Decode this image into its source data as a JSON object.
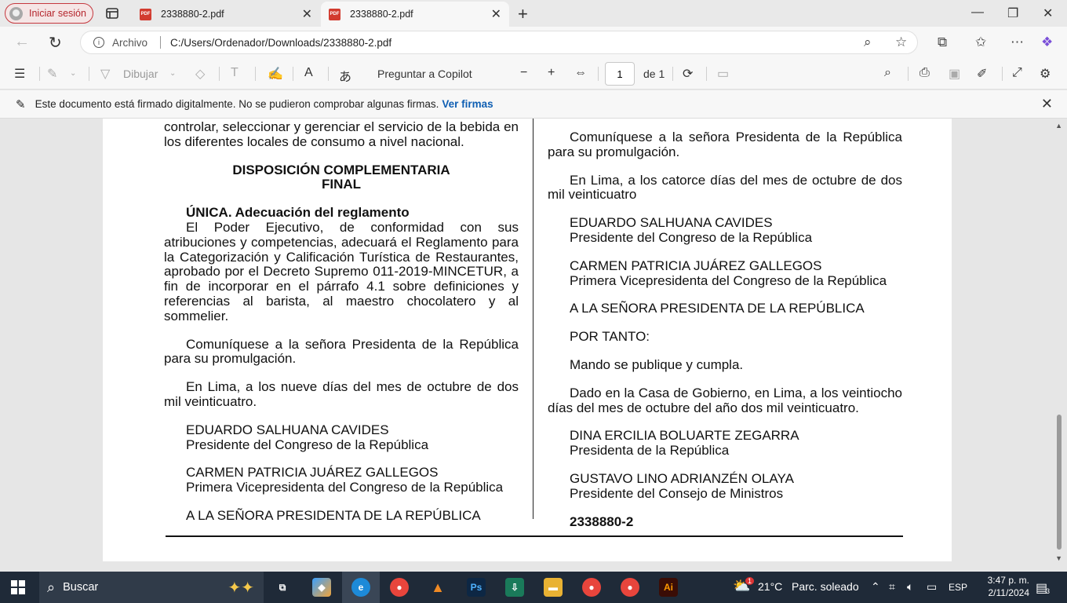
{
  "browser": {
    "signin_label": "Iniciar sesión",
    "tabs": [
      {
        "title": "2338880-2.pdf",
        "active": false
      },
      {
        "title": "2338880-2.pdf",
        "active": true
      }
    ],
    "address": {
      "scheme_label": "Archivo",
      "url": "C:/Users/Ordenador/Downloads/2338880-2.pdf"
    }
  },
  "pdf_toolbar": {
    "draw_label": "Dibujar",
    "copilot_label": "Preguntar a Copilot",
    "page_value": "1",
    "page_of": "de 1"
  },
  "signature_bar": {
    "message": "Este documento está firmado digitalmente. No se pudieron comprobar algunas firmas.",
    "link": "Ver firmas"
  },
  "document": {
    "left": {
      "top_text": "controlar, seleccionar y gerenciar el servicio de la bebida en los diferentes locales de consumo a nivel nacional.",
      "heading_line1": "DISPOSICIÓN COMPLEMENTARIA",
      "heading_line2": "FINAL",
      "article_title": "ÚNICA. Adecuación del reglamento",
      "article_body": "El Poder Ejecutivo, de conformidad con sus atribuciones y competencias, adecuará el Reglamento para la Categorización y Calificación Turística de Restaurantes, aprobado por el Decreto Supremo 011-2019-MINCETUR, a fin de incorporar en el párrafo 4.1 sobre definiciones y referencias al barista, al maestro chocolatero y al sommelier.",
      "communique": "Comuníquese a la señora Presidenta de la República para su promulgación.",
      "dated": "En Lima, a los nueve días del mes de octubre de dos mil veinticuatro.",
      "sig1_name": "EDUARDO SALHUANA CAVIDES",
      "sig1_title": "Presidente del Congreso de la República",
      "sig2_name": "CARMEN PATRICIA JUÁREZ GALLEGOS",
      "sig2_title": "Primera Vicepresidenta del Congreso de la República",
      "addressee": "A LA SEÑORA PRESIDENTA DE LA REPÚBLICA"
    },
    "right": {
      "communique": "Comuníquese a la señora Presidenta de la República para su promulgación.",
      "dated": "En Lima, a los catorce días del mes de octubre de dos mil veinticuatro",
      "sig1_name": "EDUARDO SALHUANA CAVIDES",
      "sig1_title": "Presidente del Congreso de la República",
      "sig2_name": "CARMEN PATRICIA JUÁREZ GALLEGOS",
      "sig2_title": "Primera Vicepresidenta del Congreso de la República",
      "addressee": "A LA SEÑORA PRESIDENTA DE LA REPÚBLICA",
      "por_tanto": "POR TANTO:",
      "mando": "Mando se publique y cumpla.",
      "dado": "Dado en la Casa de Gobierno, en Lima, a los veintiocho días del mes de octubre del año dos mil veinticuatro.",
      "sig3_name": "DINA ERCILIA BOLUARTE ZEGARRA",
      "sig3_title": "Presidenta de la República",
      "sig4_name": "GUSTAVO LINO ADRIANZÉN OLAYA",
      "sig4_title": "Presidente del Consejo de Ministros",
      "doc_code": "2338880-2"
    }
  },
  "taskbar": {
    "search_label": "Buscar",
    "weather_temp": "21°C",
    "weather_desc": "Parc. soleado",
    "weather_badge": "1",
    "lang": "ESP",
    "time": "3:47 p. m.",
    "date": "2/11/2024",
    "notif_count": "3"
  }
}
